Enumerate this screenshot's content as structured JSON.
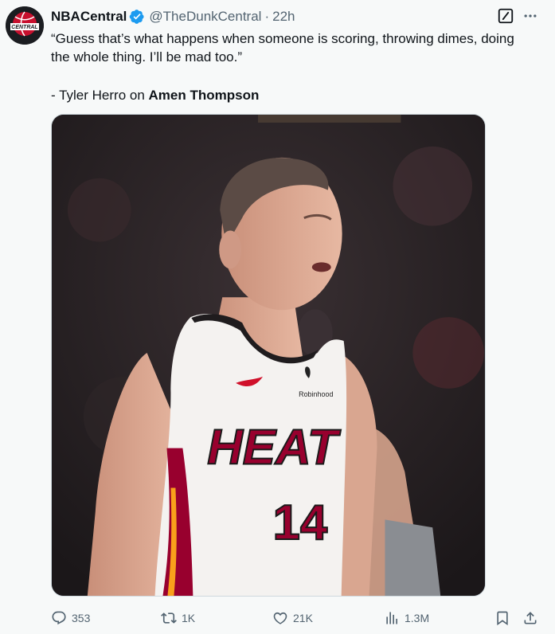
{
  "tweet": {
    "author": {
      "display_name": "NBACentral",
      "handle": "@TheDunkCentral",
      "time": "22h",
      "verified": true,
      "avatar_icon": "nbacentral-logo"
    },
    "text": {
      "line1": "“Guess that’s what happens when someone is scoring, throwing dimes, doing the whole thing. I’ll be mad too.”",
      "attribution_prefix": "- Tyler Herro on ",
      "attribution_name": "Amen Thompson"
    },
    "media": {
      "jersey_team": "HEAT",
      "jersey_number": "14",
      "jersey_sponsor": "Robinhood"
    },
    "actions": {
      "replies": "353",
      "retweets": "1K",
      "likes": "21K",
      "views": "1.3M"
    },
    "icons": {
      "grok": "grok-icon",
      "more": "more-icon",
      "reply": "reply-icon",
      "retweet": "retweet-icon",
      "like": "heart-icon",
      "views": "views-icon",
      "bookmark": "bookmark-icon",
      "share": "share-icon"
    },
    "colors": {
      "verified": "#1d9bf0",
      "secondary_text": "#536471",
      "heat_red": "#98002e"
    }
  }
}
